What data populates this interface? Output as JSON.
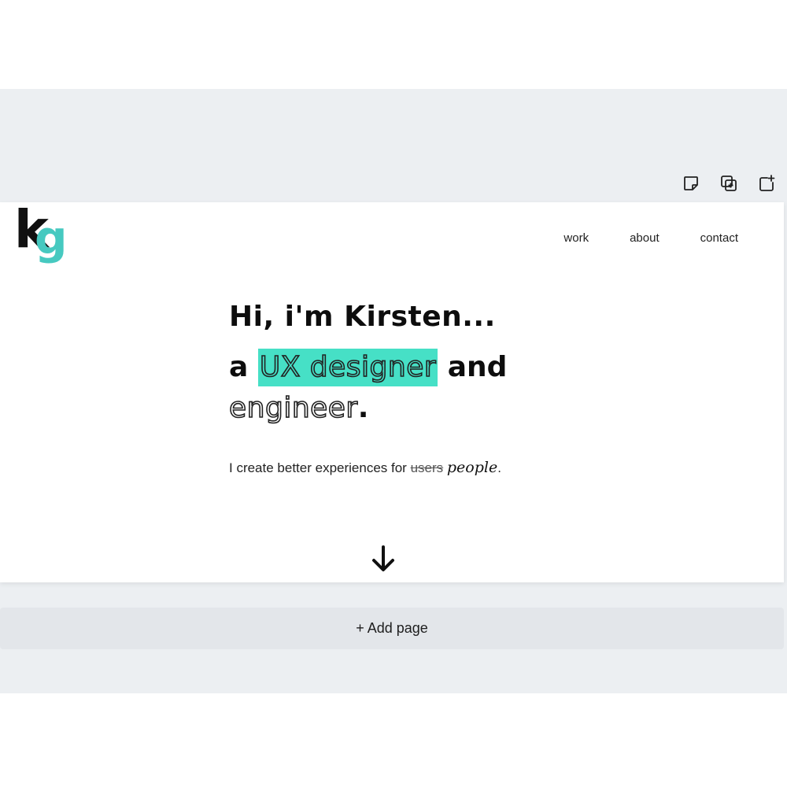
{
  "site": {
    "logo": {
      "k": "k",
      "g": "g"
    },
    "nav": [
      {
        "label": "work"
      },
      {
        "label": "about"
      },
      {
        "label": "contact"
      }
    ],
    "hero": {
      "headline": "Hi, i'm Kirsten...",
      "line2_prefix": "a",
      "line2_highlight": "UX designer",
      "line2_suffix": "and",
      "line3_word": "engineer",
      "line3_period": ".",
      "tagline_prefix": "I create better experiences for",
      "tagline_strike": "users",
      "tagline_script": "people",
      "tagline_end": "."
    }
  },
  "editor": {
    "page_actions": [
      {
        "icon": "sticky-note-icon"
      },
      {
        "icon": "duplicate-page-icon"
      },
      {
        "icon": "add-page-icon"
      }
    ],
    "add_page_label": "+ Add page"
  },
  "colors": {
    "accent": "#46e0c6",
    "logo_g": "#46c9c0",
    "editor_bg": "#eceff2"
  }
}
